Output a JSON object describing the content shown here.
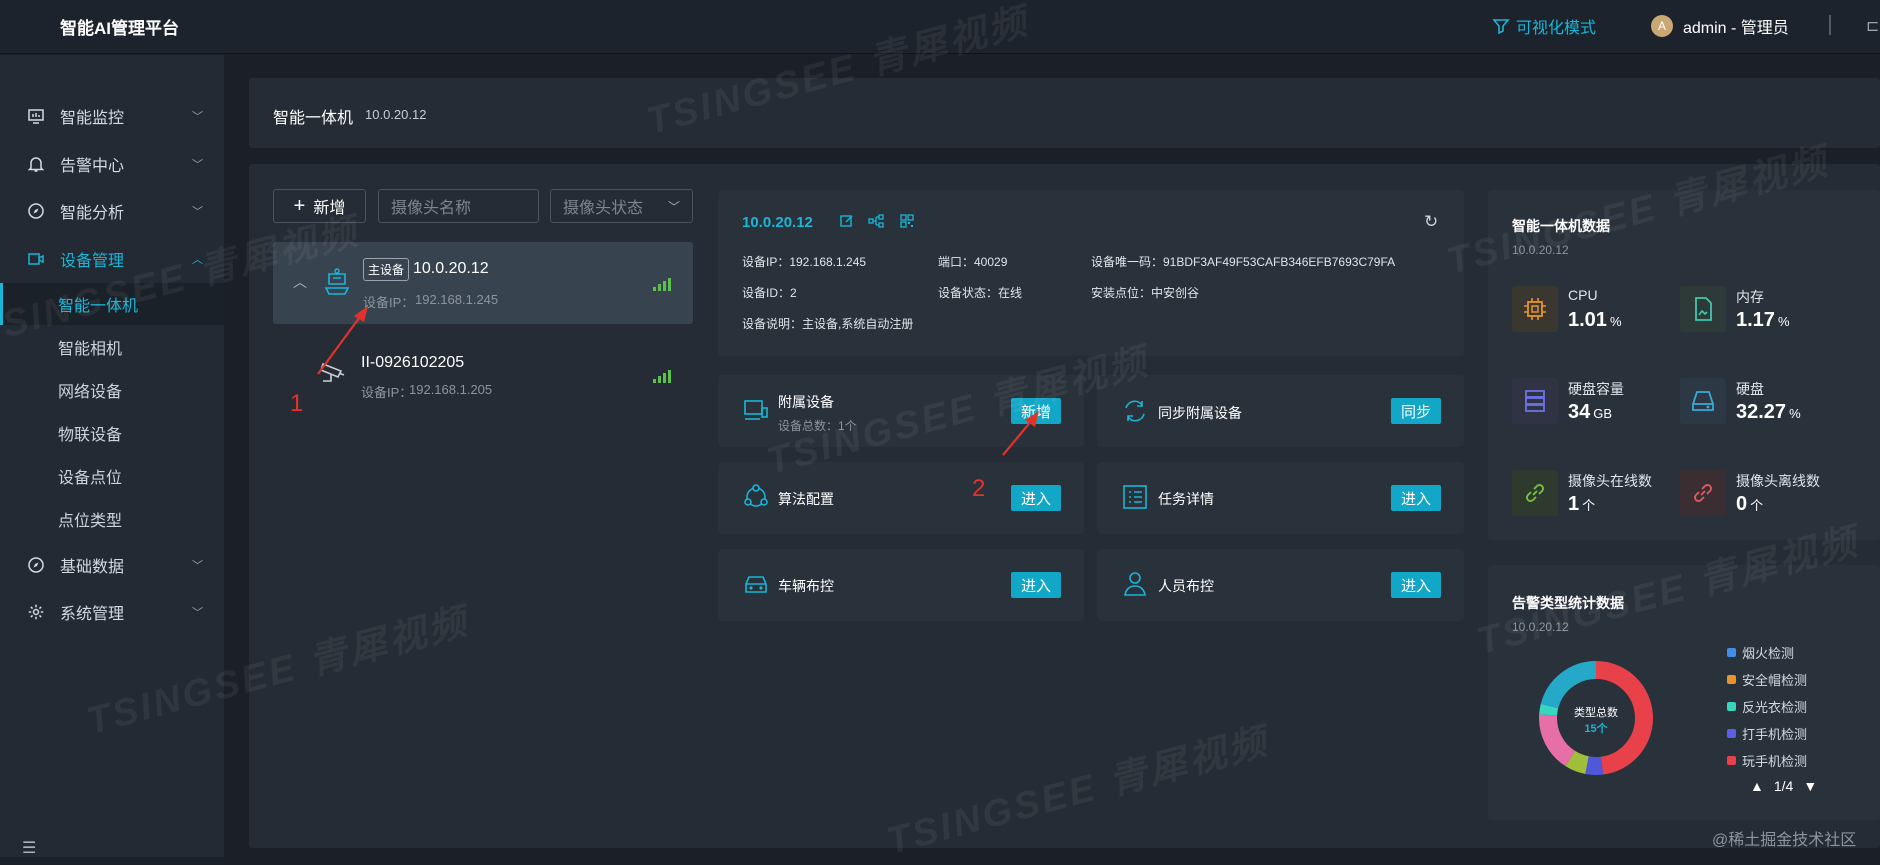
{
  "header": {
    "logo": "智能AI管理平台",
    "visual_mode": "可视化模式",
    "avatar_letter": "A",
    "user": "admin - 管理员"
  },
  "sidebar": {
    "menus": [
      {
        "label": "智能监控",
        "icon": "monitor-icon"
      },
      {
        "label": "告警中心",
        "icon": "bell-icon"
      },
      {
        "label": "智能分析",
        "icon": "compass-icon"
      },
      {
        "label": "设备管理",
        "icon": "device-icon"
      },
      {
        "label": "基础数据",
        "icon": "compass-icon"
      },
      {
        "label": "系统管理",
        "icon": "gear-icon"
      }
    ],
    "submenu": [
      "智能一体机",
      "智能相机",
      "网络设备",
      "物联设备",
      "设备点位",
      "点位类型"
    ]
  },
  "breadcrumb": {
    "title": "智能一体机",
    "ip": "10.0.20.12"
  },
  "toolbar": {
    "add": "新增",
    "name_placeholder": "摄像头名称",
    "status_placeholder": "摄像头状态"
  },
  "devices": [
    {
      "badge": "主设备",
      "name": "10.0.20.12",
      "ip_label": "设备IP：",
      "ip": "192.168.1.245"
    },
    {
      "name": "II-0926102205",
      "ip_label": "设备IP：",
      "ip": "192.168.1.205"
    }
  ],
  "detail": {
    "title": "10.0.20.12",
    "ip": "设备IP：192.168.1.245",
    "port": "端口：40029",
    "uid": "设备唯一码：91BDF3AF49F53CAFB346EFB7693C79FA",
    "id": "设备ID：2",
    "status": "设备状态：在线",
    "location": "安装点位：中安创谷",
    "desc": "设备说明：主设备,系统自动注册"
  },
  "actions": {
    "attached": {
      "title": "附属设备",
      "sub": "设备总数：1个",
      "btn": "新增"
    },
    "sync": {
      "title": "同步附属设备",
      "btn": "同步"
    },
    "algo": {
      "title": "算法配置",
      "btn": "进入"
    },
    "task": {
      "title": "任务详情",
      "btn": "进入"
    },
    "vehicle": {
      "title": "车辆布控",
      "btn": "进入"
    },
    "person": {
      "title": "人员布控",
      "btn": "进入"
    }
  },
  "stats": {
    "title": "智能一体机数据",
    "sub": "10.0.20.12",
    "cpu": {
      "label": "CPU",
      "value": "1.01",
      "unit": "%"
    },
    "mem": {
      "label": "内存",
      "value": "1.17",
      "unit": "%"
    },
    "disk_cap": {
      "label": "硬盘容量",
      "value": "34",
      "unit": "GB"
    },
    "disk": {
      "label": "硬盘",
      "value": "32.27",
      "unit": "%"
    },
    "online": {
      "label": "摄像头在线数",
      "value": "1",
      "unit": "个"
    },
    "offline": {
      "label": "摄像头离线数",
      "value": "0",
      "unit": "个"
    }
  },
  "alarm": {
    "title": "告警类型统计数据",
    "sub": "10.0.20.12",
    "center_label": "类型总数",
    "center_value": "15个",
    "legend": [
      "烟火检测",
      "安全帽检测",
      "反光衣检测",
      "打手机检测",
      "玩手机检测"
    ],
    "pager": "1/4"
  },
  "chart_data": {
    "type": "pie",
    "series": [
      {
        "value": 48,
        "color": "#e8414a"
      },
      {
        "value": 5,
        "color": "#4f58d8"
      },
      {
        "value": 6,
        "color": "#9fbf3a"
      },
      {
        "value": 17,
        "color": "#e76fa7"
      },
      {
        "value": 3,
        "color": "#38d6bf"
      },
      {
        "value": 21,
        "color": "#25a9c9"
      }
    ]
  },
  "annotations": {
    "one": "1",
    "two": "2"
  },
  "watermark": {
    "text": "TSINGSEE 青犀视频"
  },
  "credit": "@稀土掘金技术社区",
  "colors": {
    "accent": "#19b6d8",
    "button": "#13a7c7",
    "annotation": "#e2322b"
  }
}
